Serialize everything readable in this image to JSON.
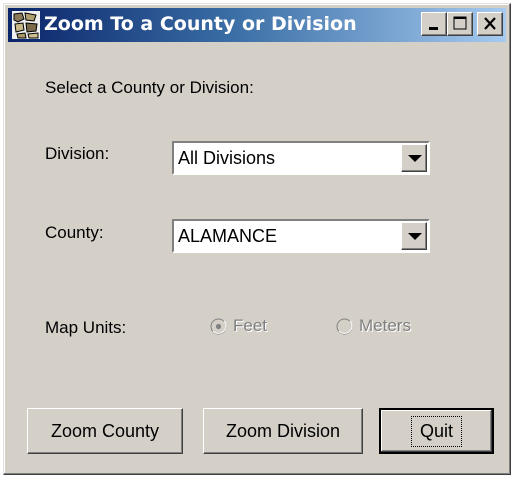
{
  "window": {
    "title": "Zoom To a County or Division",
    "icon": "map-icon",
    "controls": [
      "minimize-icon",
      "maximize-icon",
      "close-icon"
    ]
  },
  "form": {
    "prompt": "Select a County or Division:",
    "division_label": "Division:",
    "division_value": "All Divisions",
    "county_label": "County:",
    "county_value": "ALAMANCE",
    "map_units_label": "Map Units:",
    "units": [
      {
        "label": "Feet",
        "selected": true,
        "enabled": false
      },
      {
        "label": "Meters",
        "selected": false,
        "enabled": false
      }
    ]
  },
  "buttons": {
    "zoom_county": "Zoom County",
    "zoom_division": "Zoom Division",
    "quit": "Quit"
  },
  "colors": {
    "face": "#d4d0c8",
    "title_start": "#0a246a",
    "title_end": "#a6caf0",
    "disabled_text": "#808080"
  }
}
